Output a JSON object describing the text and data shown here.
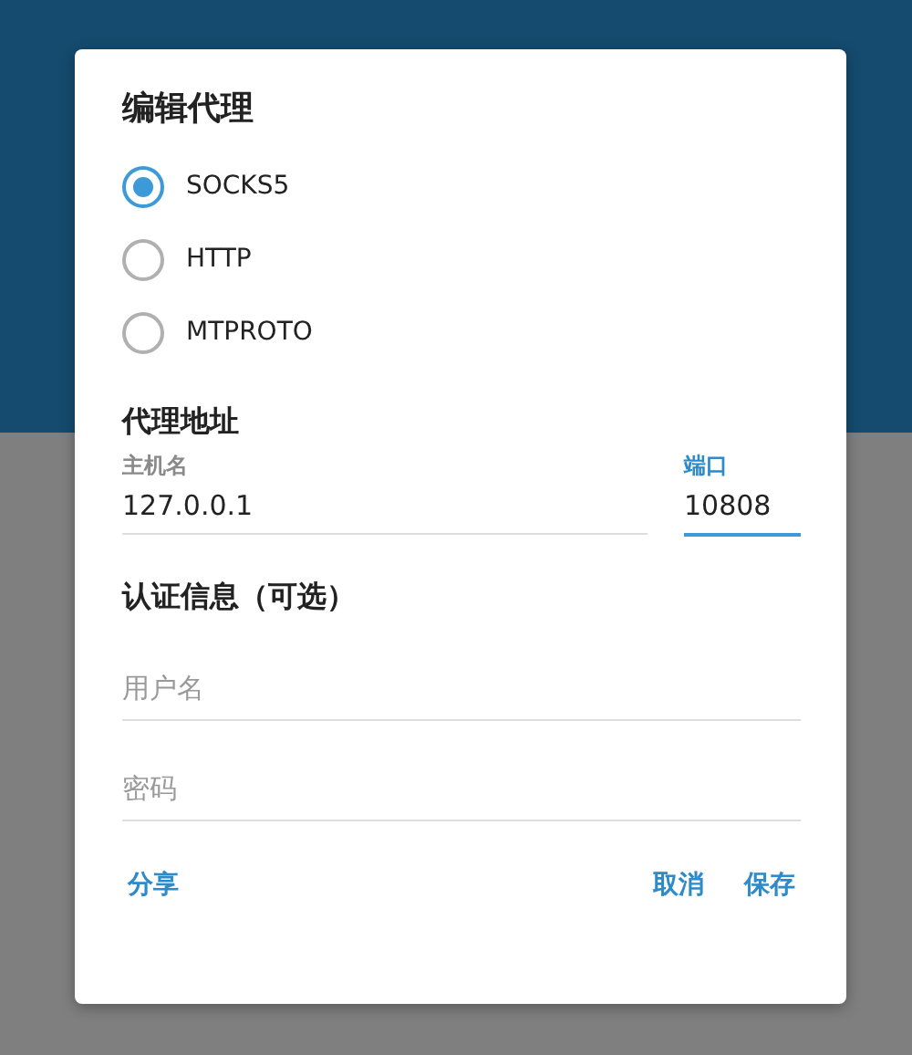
{
  "dialog": {
    "title": "编辑代理",
    "proxy_types": [
      {
        "label": "SOCKS5",
        "selected": true
      },
      {
        "label": "HTTP",
        "selected": false
      },
      {
        "label": "MTPROTO",
        "selected": false
      }
    ],
    "address_section": {
      "heading": "代理地址",
      "host": {
        "label": "主机名",
        "value": "127.0.0.1",
        "focused": false
      },
      "port": {
        "label": "端口",
        "value": "10808",
        "focused": true
      }
    },
    "auth_section": {
      "heading": "认证信息（可选）",
      "username": {
        "placeholder": "用户名"
      },
      "password": {
        "placeholder": "密码"
      }
    },
    "buttons": {
      "left": [
        "分享"
      ],
      "right": [
        "取消",
        "保存"
      ]
    }
  }
}
